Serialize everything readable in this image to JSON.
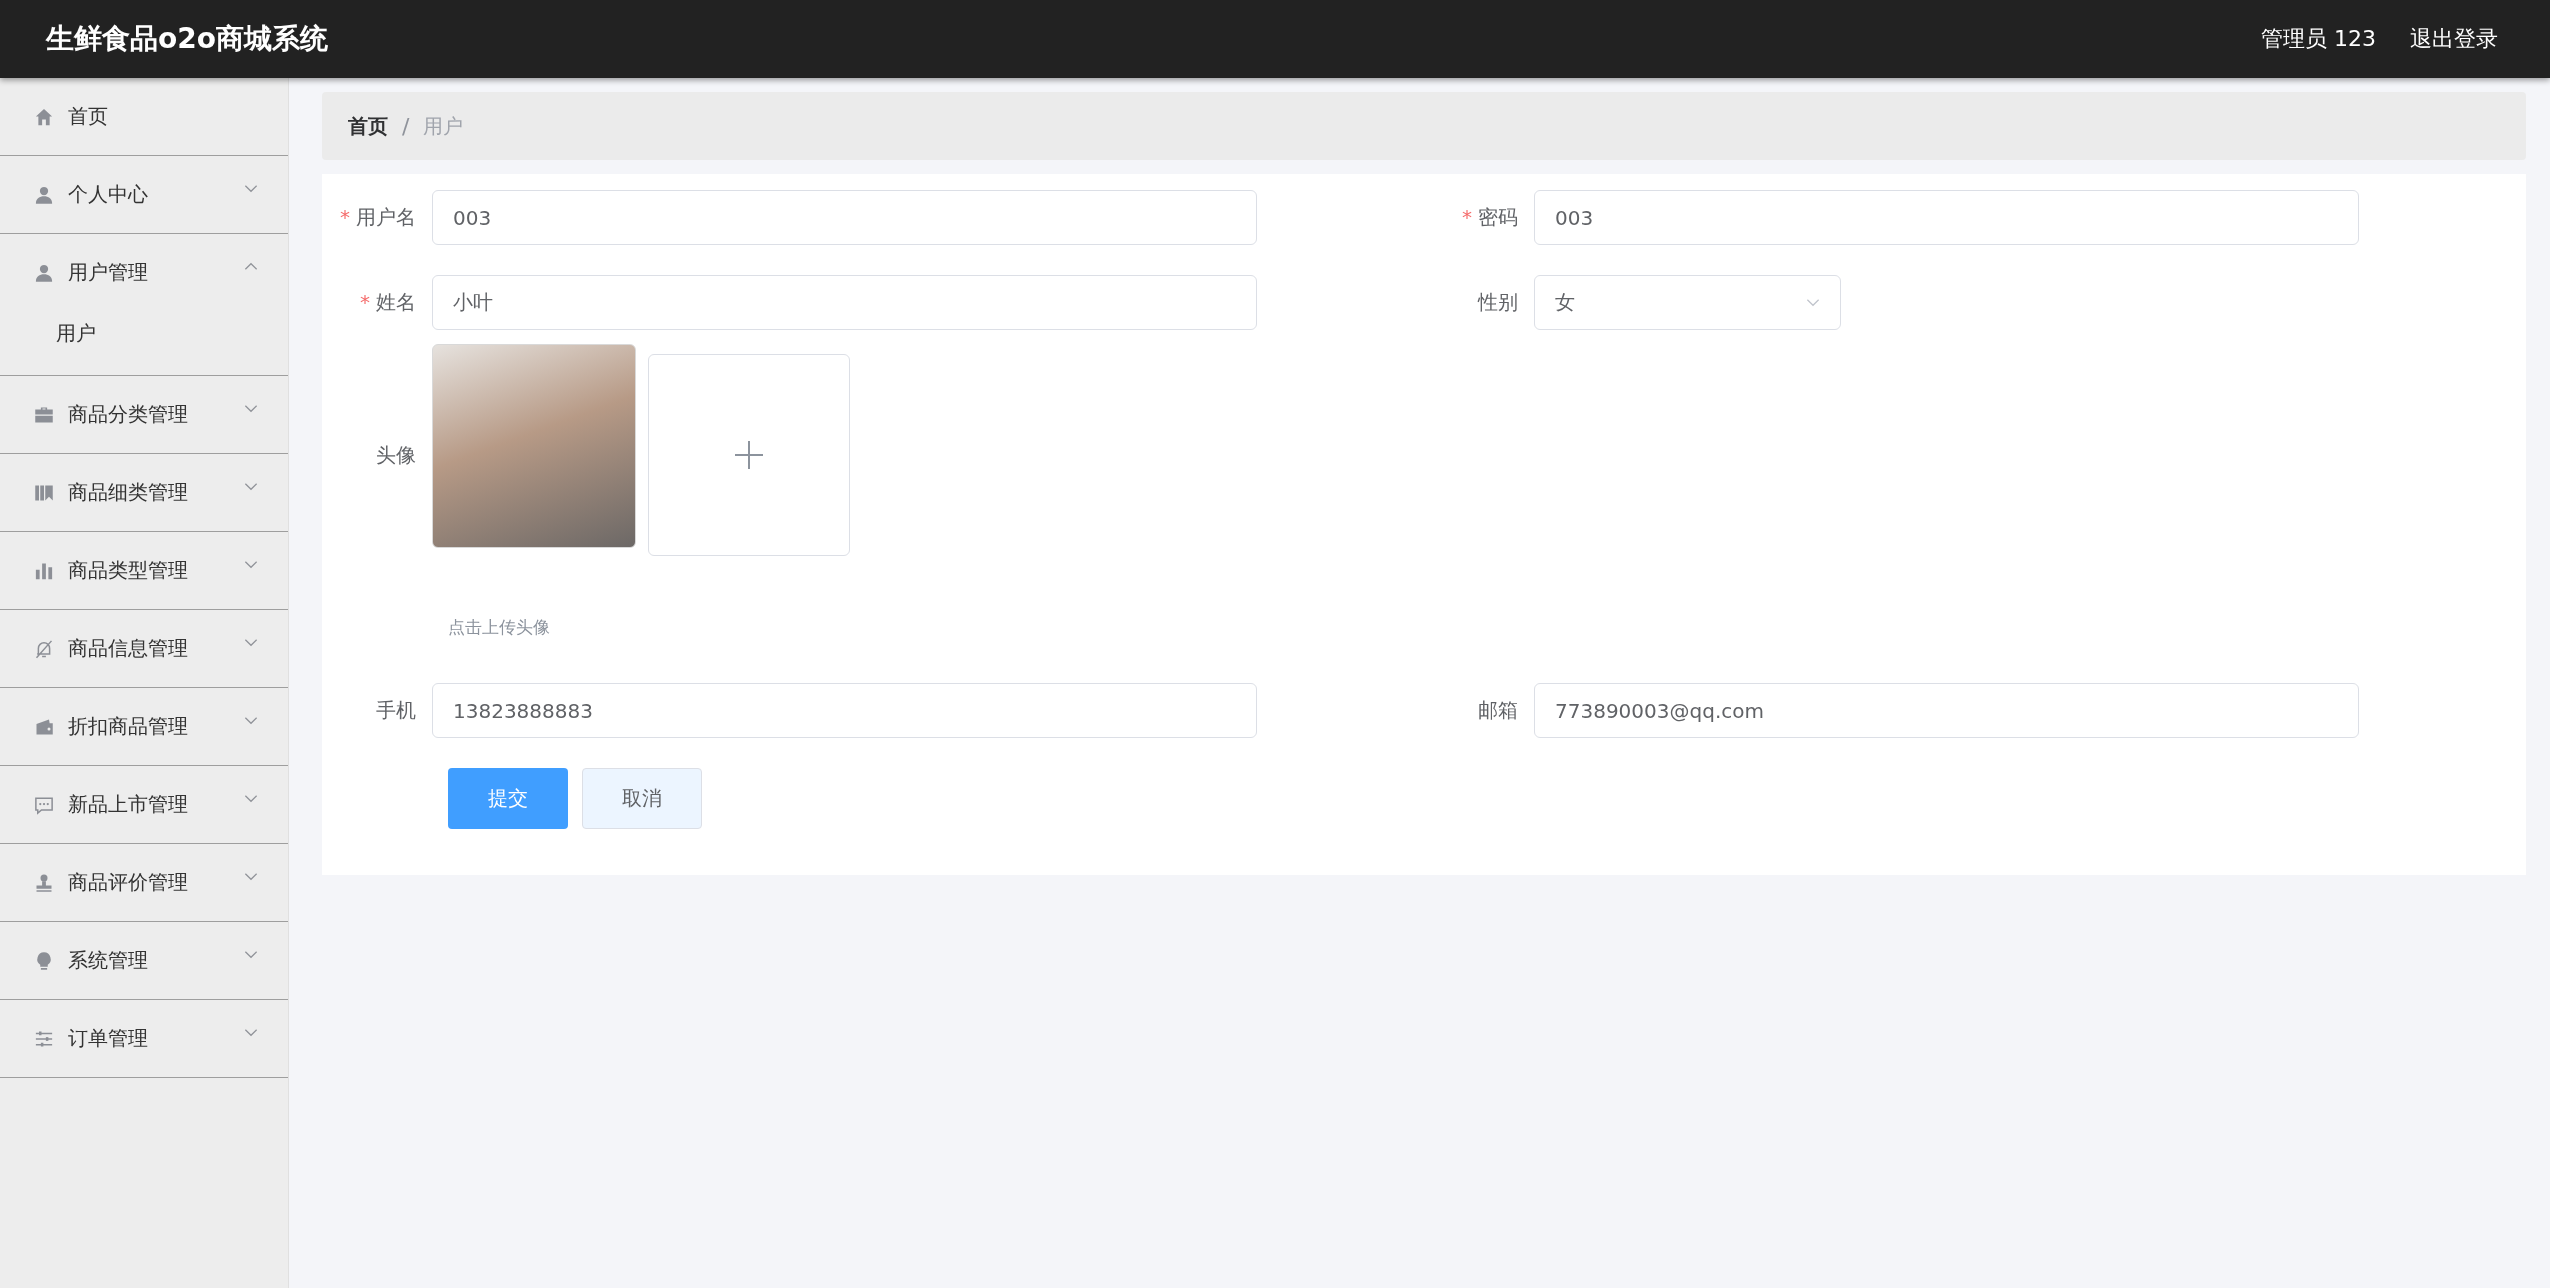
{
  "header": {
    "title": "生鲜食品o2o商城系统",
    "user": "管理员 123",
    "logout": "退出登录"
  },
  "sidebar": {
    "items": [
      {
        "label": "首页"
      },
      {
        "label": "个人中心",
        "expanded": false
      },
      {
        "label": "用户管理",
        "expanded": true,
        "children": [
          {
            "label": "用户"
          }
        ]
      },
      {
        "label": "商品分类管理",
        "expanded": false
      },
      {
        "label": "商品细类管理",
        "expanded": false
      },
      {
        "label": "商品类型管理",
        "expanded": false
      },
      {
        "label": "商品信息管理",
        "expanded": false
      },
      {
        "label": "折扣商品管理",
        "expanded": false
      },
      {
        "label": "新品上市管理",
        "expanded": false
      },
      {
        "label": "商品评价管理",
        "expanded": false
      },
      {
        "label": "系统管理",
        "expanded": false
      },
      {
        "label": "订单管理",
        "expanded": false
      }
    ]
  },
  "breadcrumb": {
    "separator": "/",
    "items": [
      "首页",
      "用户"
    ]
  },
  "form": {
    "required_mark": "*",
    "fields": [
      {
        "kind": "input",
        "label": "用户名",
        "required": true,
        "value": "003"
      },
      {
        "kind": "input",
        "label": "密码",
        "required": true,
        "value": "003"
      },
      {
        "kind": "input",
        "label": "姓名",
        "required": true,
        "value": "小叶"
      },
      {
        "kind": "select",
        "label": "性别",
        "required": false,
        "value": "女"
      },
      {
        "kind": "avatar",
        "label": "头像",
        "required": false,
        "hint": "点击上传头像"
      },
      {
        "kind": "input",
        "label": "手机",
        "required": false,
        "value": "13823888883"
      },
      {
        "kind": "input",
        "label": "邮箱",
        "required": false,
        "value": "773890003@qq.com"
      }
    ],
    "buttons": [
      {
        "label": "提交",
        "kind": "primary"
      },
      {
        "label": "取消",
        "kind": "plain"
      }
    ]
  }
}
